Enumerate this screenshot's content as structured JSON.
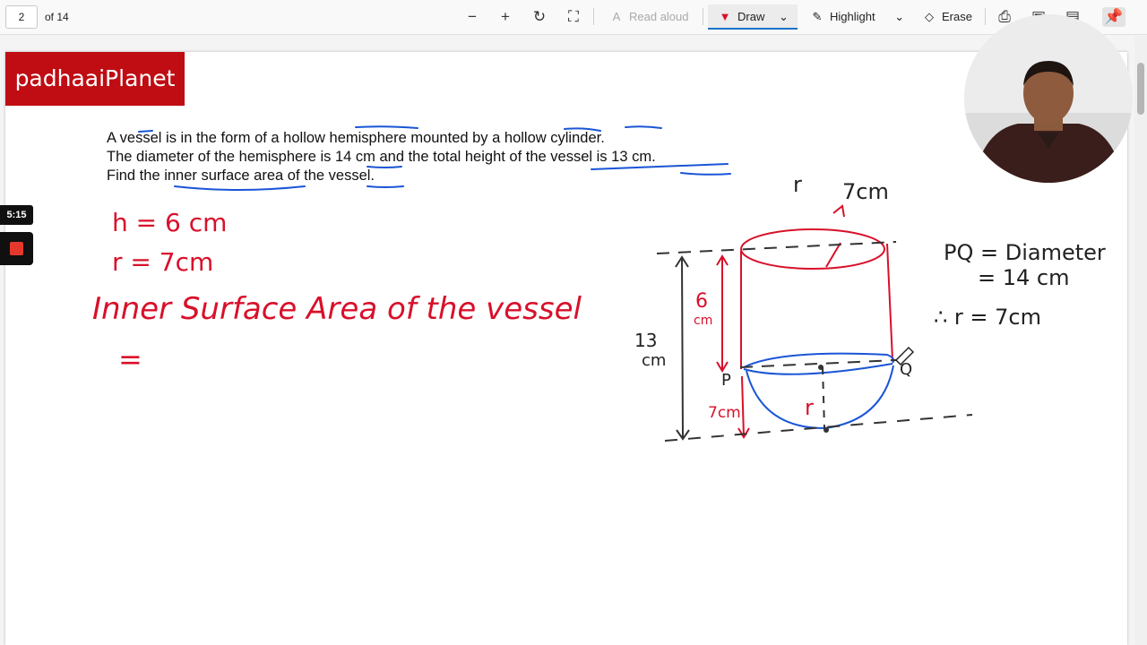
{
  "toolbar": {
    "page_number": "2",
    "page_of": "of 14",
    "read_aloud": "Read aloud",
    "draw": "Draw",
    "highlight": "Highlight",
    "erase": "Erase"
  },
  "document": {
    "logo": "padhaaiPlanet",
    "question": {
      "line1": "A vessel is in the form of a hollow hemisphere mounted by a hollow cylinder.",
      "line2": "The diameter of the hemisphere is 14 cm and the total height of the vessel is 13 cm.",
      "line3": "Find the inner surface area of the vessel."
    }
  },
  "recorder": {
    "time": "5:15"
  },
  "handwriting": {
    "h": "h = 6 cm",
    "r": "r = 7cm",
    "title": "Inner Surface Area of the vessel",
    "eq": "=",
    "r_top": "r",
    "r_top_val": "7cm",
    "six": "6",
    "six_cm": "cm",
    "thirteen": "13",
    "thirteen_cm": "cm",
    "seven_cm": "7cm",
    "p": "P",
    "q": "Q",
    "r_hemi": "r",
    "pq1": "PQ = Diameter",
    "pq2": "= 14 cm",
    "pq3": "∴ r = 7cm"
  },
  "colors": {
    "red_ink": "#d8102a",
    "blue_ink": "#1a55d6",
    "brand": "#bf0d13"
  }
}
